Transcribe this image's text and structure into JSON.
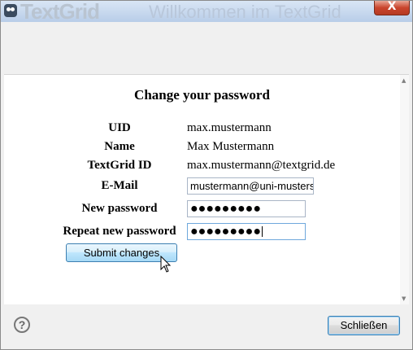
{
  "window": {
    "bg_logo_text": "TextGrid",
    "bg_title_text": "Willkommen im TextGrid",
    "close_glyph": "X"
  },
  "form": {
    "heading": "Change your password",
    "fields": [
      {
        "label": "UID",
        "value": "max.mustermann"
      },
      {
        "label": "Name",
        "value": "Max Mustermann"
      },
      {
        "label": "TextGrid ID",
        "value": "max.mustermann@textgrid.de"
      },
      {
        "label": "E-Mail",
        "value": "mustermann@uni-musters"
      },
      {
        "label": "New password",
        "value": "●●●●●●●●●"
      },
      {
        "label": "Repeat new password",
        "value": "●●●●●●●●●"
      }
    ],
    "submit_label": "Submit changes"
  },
  "footer": {
    "help_glyph": "?",
    "close_label": "Schließen"
  },
  "icons": {
    "app": "owl-icon",
    "help": "help-icon",
    "cursor": "mouse-pointer-icon"
  },
  "colors": {
    "accent_border": "#3c7fb1",
    "titlebar": "#c7d8ee",
    "close_red": "#c9442c"
  }
}
